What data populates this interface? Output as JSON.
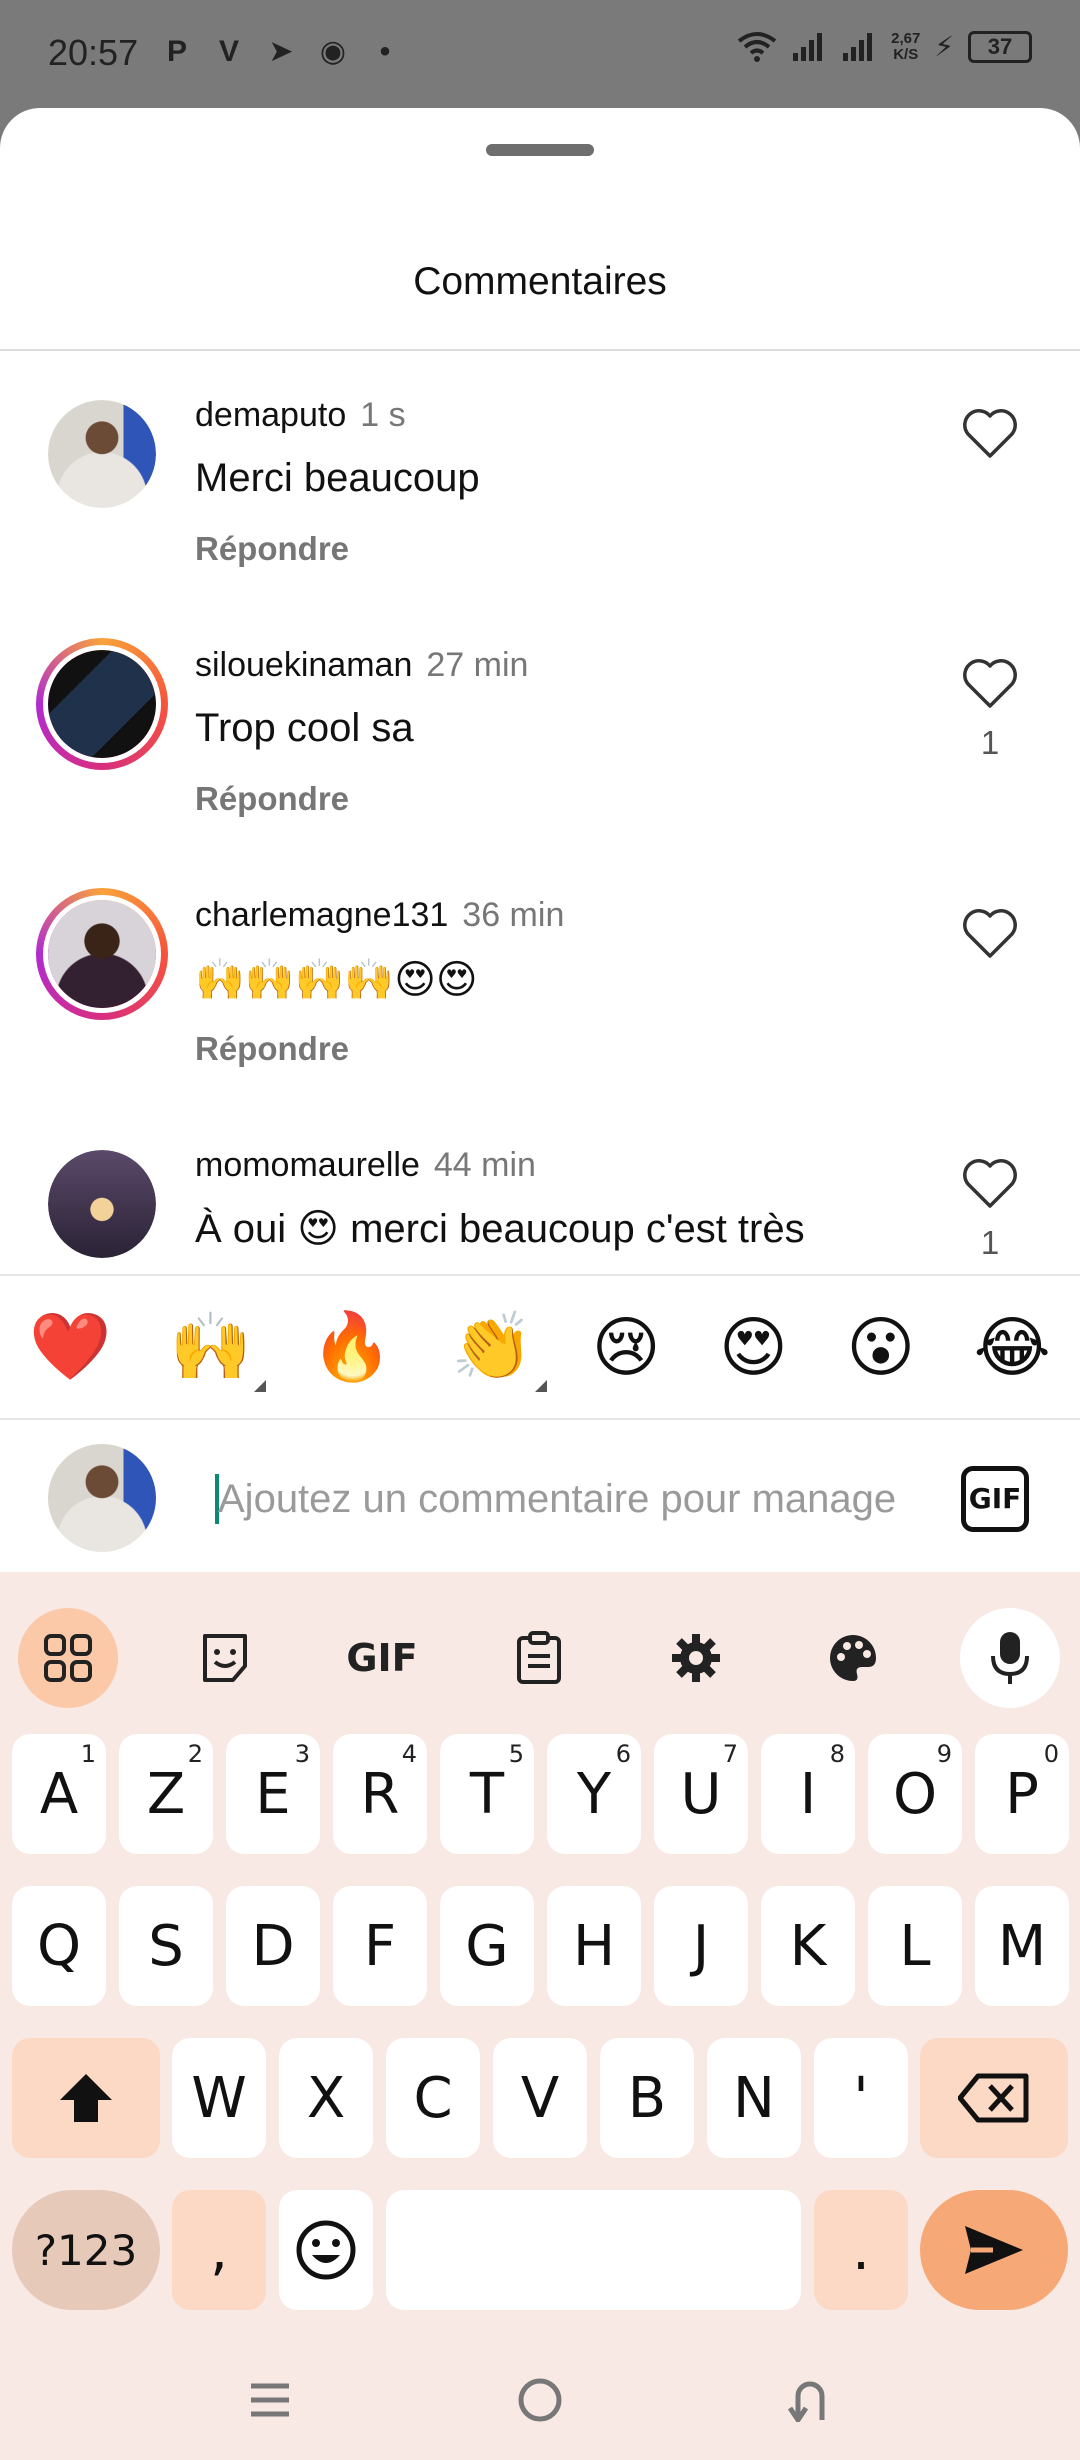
{
  "status_bar": {
    "time": "20:57",
    "app_icons": [
      "P",
      "V",
      "➤",
      "◉",
      "•"
    ],
    "net_speed_top": "2,67",
    "net_speed_bottom": "K/S",
    "battery": "37"
  },
  "sheet": {
    "title": "Commentaires"
  },
  "comments": [
    {
      "username": "demaputo",
      "time": "1 s",
      "text": "Merci beaucoup",
      "reply_label": "Répondre",
      "likes": ""
    },
    {
      "username": "silouekinaman",
      "time": "27 min",
      "text": "Trop cool sa",
      "reply_label": "Répondre",
      "likes": "1"
    },
    {
      "username": "charlemagne131",
      "time": "36 min",
      "text": "🙌🙌🙌🙌😍😍",
      "reply_label": "Répondre",
      "likes": ""
    },
    {
      "username": "momomaurelle",
      "time": "44 min",
      "text": "À oui 😍 merci beaucoup c'est très",
      "reply_label": "",
      "likes": "1"
    }
  ],
  "reactions": [
    "❤️",
    "🙌",
    "🔥",
    "👏",
    "😢",
    "😍",
    "😮",
    "😂"
  ],
  "comment_input": {
    "placeholder": "Ajoutez un commentaire pour manage",
    "gif_label": "GIF"
  },
  "keyboard": {
    "toolbar_gif": "GIF",
    "row1": [
      {
        "k": "A",
        "h": "1"
      },
      {
        "k": "Z",
        "h": "2"
      },
      {
        "k": "E",
        "h": "3"
      },
      {
        "k": "R",
        "h": "4"
      },
      {
        "k": "T",
        "h": "5"
      },
      {
        "k": "Y",
        "h": "6"
      },
      {
        "k": "U",
        "h": "7"
      },
      {
        "k": "I",
        "h": "8"
      },
      {
        "k": "O",
        "h": "9"
      },
      {
        "k": "P",
        "h": "0"
      }
    ],
    "row2": [
      "Q",
      "S",
      "D",
      "F",
      "G",
      "H",
      "J",
      "K",
      "L",
      "M"
    ],
    "row3": [
      "W",
      "X",
      "C",
      "V",
      "B",
      "N",
      "'"
    ],
    "symbols_key": "?123",
    "comma_key": ",",
    "period_key": "."
  }
}
